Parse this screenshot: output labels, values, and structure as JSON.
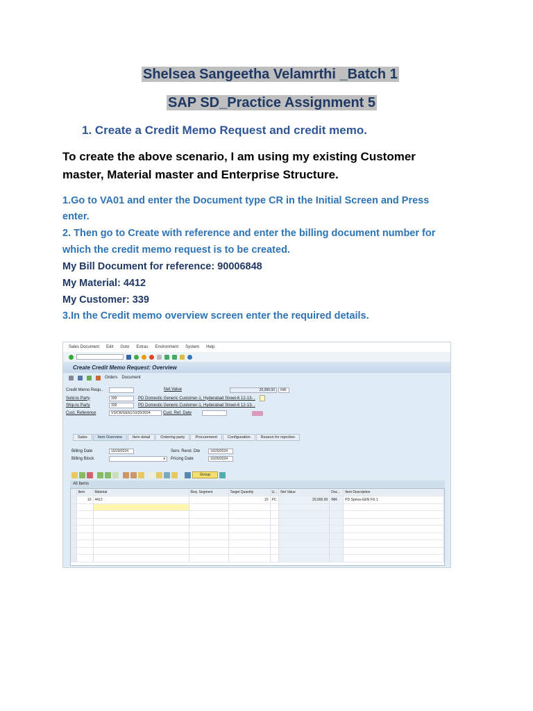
{
  "doc": {
    "author_title": "Shelsea Sangeetha Velamrthi _Batch 1",
    "assignment_title": "SAP SD_Practice Assignment 5",
    "heading": "1.  Create a Credit Memo Request and credit memo.",
    "intro_1": "To create the above scenario, I am using my existing Customer",
    "intro_2": "master, Material master and Enterprise Structure.",
    "step1_a": "1.Go to VA01 and enter the Document type CR in the Initial Screen and Press",
    "step1_b": "enter.",
    "step2_a": "2. Then go to Create with reference and enter the billing document number for",
    "step2_b": "which the credit memo request is to be created.",
    "bill_doc": "My Bill Document for reference: 90006848",
    "material": "My Material: 4412",
    "customer": "My Customer: 339",
    "step3": "3.In the Credit memo overview screen enter the required details."
  },
  "sap": {
    "menu": [
      "Sales Document",
      "Edit",
      "Goto",
      "Extras",
      "Environment",
      "System",
      "Help"
    ],
    "screen_title": "Create Credit Memo Request: Overview",
    "orders_btn": "Orders",
    "document_btn": "Document",
    "labels": {
      "credit_memo_req": "Credit Memo Requ..",
      "net_value": "Net Value",
      "sold_to": "Sold-to Party",
      "ship_to": "Ship-to Party",
      "cust_ref": "Cust. Reference",
      "cust_ref_date": "Cust. Ref. Date",
      "billing_date": "Billing Date",
      "billing_block": "Billing Block",
      "serv_rend": "Serv. Rend. Dte",
      "pricing_date": "Pricing Date"
    },
    "values": {
      "net_value": "20,000.00",
      "currency": "INR",
      "sold_to": "339",
      "sold_to_desc": "PD Domestic Generic  Customer-1, Hyderabad Street-6 12-13- .",
      "ship_to": "339",
      "ship_to_desc": "PD Domestic Generic  Customer-1, Hyderabad Street-6 12-13- .",
      "cust_ref": "VS/CR/GEN1/10/20/2024",
      "billing_date": "10/20/2024",
      "serv_rend": "10/20/2024",
      "pricing_date": "10/20/2024"
    },
    "tabs": [
      "Sales",
      "Item Overview",
      "Item detail",
      "Ordering party",
      "Procurement",
      "Configuration",
      "Reason for rejection"
    ],
    "group_btn": "Group",
    "all_items": "All Items",
    "columns": [
      "Item",
      "Material",
      "Req. Segment",
      "Target Quantity",
      "U...",
      "Net Value",
      "Doc...",
      "Item Description"
    ],
    "items": [
      {
        "item": "10",
        "material": "4412",
        "qty": "10",
        "unit": "PC",
        "net": "20,000.00",
        "cur": "INR",
        "desc": "PD Spriva-GEN FG 1"
      }
    ]
  }
}
